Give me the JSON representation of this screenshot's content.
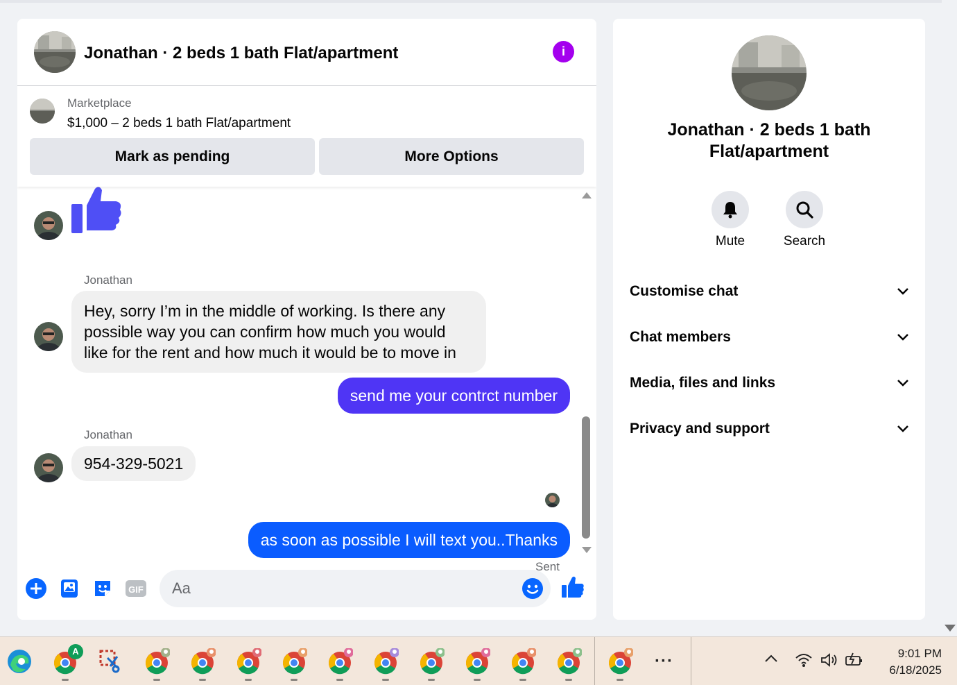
{
  "chat": {
    "title": "Jonathan · 2 beds 1 bath Flat/apartment",
    "listing": {
      "source": "Marketplace",
      "price_line": "$1,000 – 2 beds 1 bath Flat/apartment",
      "mark_pending": "Mark as pending",
      "more_options": "More Options"
    },
    "messages": {
      "sender1": "Jonathan",
      "msg1": "Hey, sorry I’m in the middle of working. Is there any possible way you can confirm how much you would like for the rent and how much it would be to move in",
      "reply1": "send me your contrct number",
      "sender2": "Jonathan",
      "msg2": "954-329-5021",
      "reply2": "as soon as possible I will text you..Thanks",
      "status": "Sent"
    },
    "composer": {
      "placeholder": "Aa",
      "gif": "GIF"
    }
  },
  "info_panel": {
    "name": "Jonathan · 2 beds 1 bath Flat/apartment",
    "actions": {
      "mute": "Mute",
      "search": "Search"
    },
    "menu": {
      "customise": "Customise chat",
      "members": "Chat members",
      "media": "Media, files and links",
      "privacy": "Privacy and support"
    }
  },
  "taskbar": {
    "time": "9:01 PM",
    "date": "6/18/2025",
    "more": "···",
    "chrome_badge_letter": "A"
  },
  "colors": {
    "accent_blue": "#0a5cff",
    "accent_purple": "#4f35f5",
    "info_purple": "#a400ee",
    "thumb_blue": "#0866ff"
  }
}
